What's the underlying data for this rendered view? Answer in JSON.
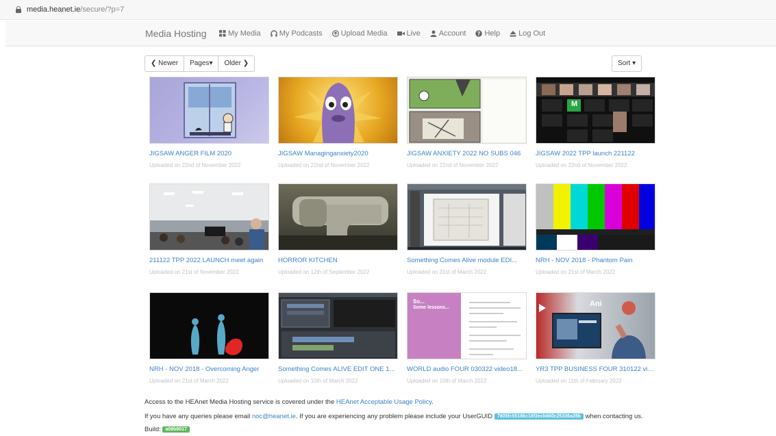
{
  "browser": {
    "url_host": "media.heanet.ie",
    "url_path": "/secure/?p=7"
  },
  "nav": {
    "brand": "Media Hosting",
    "links": [
      {
        "label": "My Media",
        "icon": "grid-icon"
      },
      {
        "label": "My Podcasts",
        "icon": "headphones-icon"
      },
      {
        "label": "Upload Media",
        "icon": "upload-icon"
      },
      {
        "label": "Live",
        "icon": "video-camera-icon"
      },
      {
        "label": "Account",
        "icon": "user-icon"
      },
      {
        "label": "Help",
        "icon": "help-icon"
      },
      {
        "label": "Log Out",
        "icon": "eject-icon"
      }
    ]
  },
  "pager": {
    "newer": "Newer",
    "pages": "Pages",
    "older": "Older"
  },
  "sort": {
    "label": "Sort"
  },
  "media": [
    {
      "title": "JIGSAW ANGER FILM 2020",
      "date": "Uploaded on 22nd of November 2022"
    },
    {
      "title": "JIGSAW Managinganxiety2020",
      "date": "Uploaded on 22nd of November 2022"
    },
    {
      "title": "JIGSAW ANXIETY 2022 NO SUBS 046",
      "date": "Uploaded on 22nd of November 2022"
    },
    {
      "title": "JIGSAW 2022 TPP launch 221122",
      "date": "Uploaded on 22nd of November 2022"
    },
    {
      "title": "211122 TPP 2022 LAUNCH meet again",
      "date": "Uploaded on 21st of November 2022"
    },
    {
      "title": "HORROR KITCHEN",
      "date": "Uploaded on 12th of September 2022"
    },
    {
      "title": "Something Comes Alive module EDI...",
      "date": "Uploaded on 31st of March 2022"
    },
    {
      "title": "NRH - NOV 2018 - Phantom Pain",
      "date": "Uploaded on 21st of March 2022"
    },
    {
      "title": "NRH - NOV 2018 - Overcoming Anger",
      "date": "Uploaded on 21st of March 2022"
    },
    {
      "title": "Something Comes ALIVE EDIT ONE 1...",
      "date": "Uploaded on 10th of March 2022"
    },
    {
      "title": "WORLD audio FOUR 030322 video18...",
      "date": "Uploaded on 10th of March 2022"
    },
    {
      "title": "YR3 TPP BUSINESS FOUR 310122 vid...",
      "date": "Uploaded on 11th of February 2022"
    }
  ],
  "thumb_text": {
    "m_tile": "M",
    "so_title": "So...",
    "so_sub": "Some lessons...",
    "ani": "Ani"
  },
  "footer": {
    "aup_prefix": "Access to the HEAnet Media Hosting service is covered under the ",
    "aup_link": "HEAnet Acceptable Usage Policy",
    "aup_suffix": ".",
    "query_prefix": "If you have any queries please email ",
    "email": "noc@heanet.ie",
    "query_mid": ". If you are experiencing any problem please include your UserGUID ",
    "guid": "7805fc55186c18f2ecb660c25336a28b",
    "query_suffix": " when contacting us.",
    "build_label": "Build:",
    "build": "a08b8017"
  },
  "colors": {
    "link": "#3c82c8",
    "guid_badge": "#5bc0de",
    "build_badge": "#5cb85c"
  }
}
